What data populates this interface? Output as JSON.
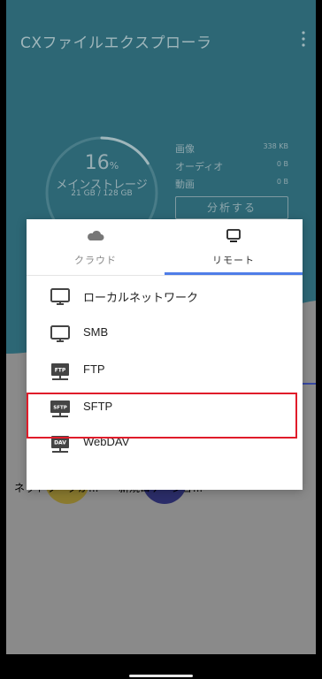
{
  "app": {
    "title": "CXファイルエクスプローラ"
  },
  "storage": {
    "percent": "16",
    "percent_unit": "%",
    "label": "メインストレージ",
    "usage": "21 GB / 128 GB",
    "used_fraction": 0.16
  },
  "stats": [
    {
      "label": "画像",
      "value": "338 KB"
    },
    {
      "label": "オーディオ",
      "value": "0 B"
    },
    {
      "label": "動画",
      "value": "0 B"
    }
  ],
  "analyze_label": "分析する",
  "dialog": {
    "tabs": [
      {
        "label": "クラウド",
        "icon": "cloud-icon"
      },
      {
        "label": "リモート",
        "icon": "monitor-icon",
        "selected": true
      }
    ],
    "items": [
      {
        "label": "ローカルネットワーク",
        "icon": "monitor-icon"
      },
      {
        "label": "SMB",
        "icon": "monitor-icon"
      },
      {
        "label": "FTP",
        "icon": "ftp-server-icon",
        "badge": "FTP"
      },
      {
        "label": "SFTP",
        "icon": "sftp-server-icon",
        "badge": "SFTP"
      },
      {
        "label": "WebDAV",
        "icon": "webdav-server-icon",
        "badge": "DAV",
        "highlighted": true
      }
    ]
  },
  "shortcuts": [
    {
      "label": "ネットワークか..."
    },
    {
      "label": "新規ロケーショ..."
    }
  ],
  "colors": {
    "appbar": "#2d6775",
    "accent": "#4f7de8",
    "highlight": "#e01c2a"
  }
}
